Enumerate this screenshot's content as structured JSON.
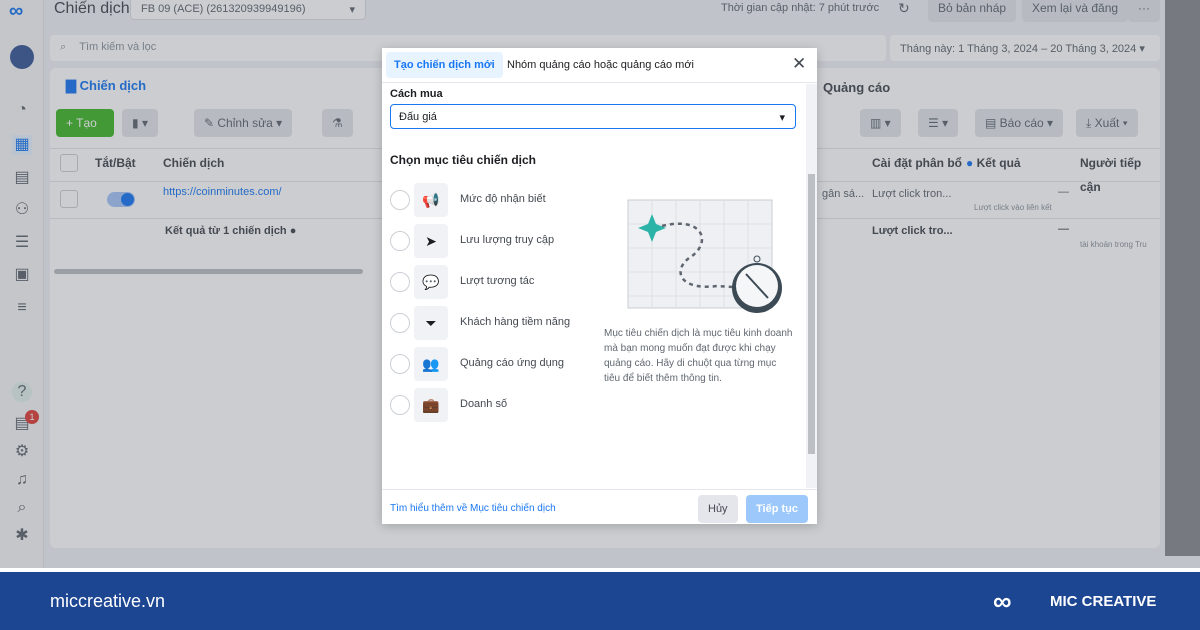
{
  "header": {
    "title": "Chiến dịch",
    "account": "FB 09 (ACE) (261320939949196)",
    "updated": "Thời gian cập nhật: 7 phút trước",
    "discard_label": "Bỏ bản nháp",
    "review_label": "Xem lại và đăng",
    "more_label": "···"
  },
  "search": {
    "placeholder": "Tìm kiếm và lọc"
  },
  "date_range": "Tháng này: 1 Tháng 3, 2024 – 20 Tháng 3, 2024",
  "tabs": {
    "campaigns": "Chiến dịch",
    "ads": "Quảng cáo"
  },
  "toolbar": {
    "create": "+ Tạo",
    "edit": "Chỉnh sửa",
    "report": "Báo cáo",
    "export": "Xuất"
  },
  "table": {
    "headers": [
      "Tắt/Bật",
      "Chiến dịch",
      "Cài đặt phân bổ",
      "Kết quả",
      "Người tiếp cận"
    ],
    "row": {
      "name": "https://coinminutes.com/",
      "budget": "gân sá...",
      "attribution": "Lượt click tron...",
      "result": "—",
      "result_sub": "Lượt click vào liên kết"
    },
    "summary": {
      "label": "Kết quả từ 1 chiến dịch",
      "attribution": "Lượt click tro...",
      "result": "—",
      "reach_sub": "tài khoản trong Tru"
    }
  },
  "modal": {
    "tab_active": "Tạo chiến dịch mới",
    "tab_other": "Nhóm quảng cáo hoặc quảng cáo mới",
    "buying_label": "Cách mua",
    "buying_value": "Đấu giá",
    "objective_title": "Chọn mục tiêu chiến dịch",
    "objectives": [
      {
        "label": "Mức độ nhận biết",
        "icon": "megaphone-icon"
      },
      {
        "label": "Lưu lượng truy cập",
        "icon": "cursor-icon"
      },
      {
        "label": "Lượt tương tác",
        "icon": "chat-icon"
      },
      {
        "label": "Khách hàng tiềm năng",
        "icon": "funnel-icon"
      },
      {
        "label": "Quảng cáo ứng dụng",
        "icon": "people-icon"
      },
      {
        "label": "Doanh số",
        "icon": "briefcase-icon"
      }
    ],
    "description": "Mục tiêu chiến dịch là mục tiêu kinh doanh mà bạn mong muốn đạt được khi chạy quảng cáo. Hãy di chuột qua từng mục tiêu để biết thêm thông tin.",
    "learn_more": "Tìm hiểu thêm về Mục tiêu chiến dịch",
    "cancel": "Hủy",
    "continue": "Tiếp tục"
  },
  "sidebar": {
    "badge": "1"
  },
  "footer": {
    "site": "miccreative.vn",
    "brand": "MIC CREATIVE"
  },
  "colors": {
    "accent": "#1877f2",
    "footer": "#1c4592",
    "teal": "#2ab3a6"
  }
}
